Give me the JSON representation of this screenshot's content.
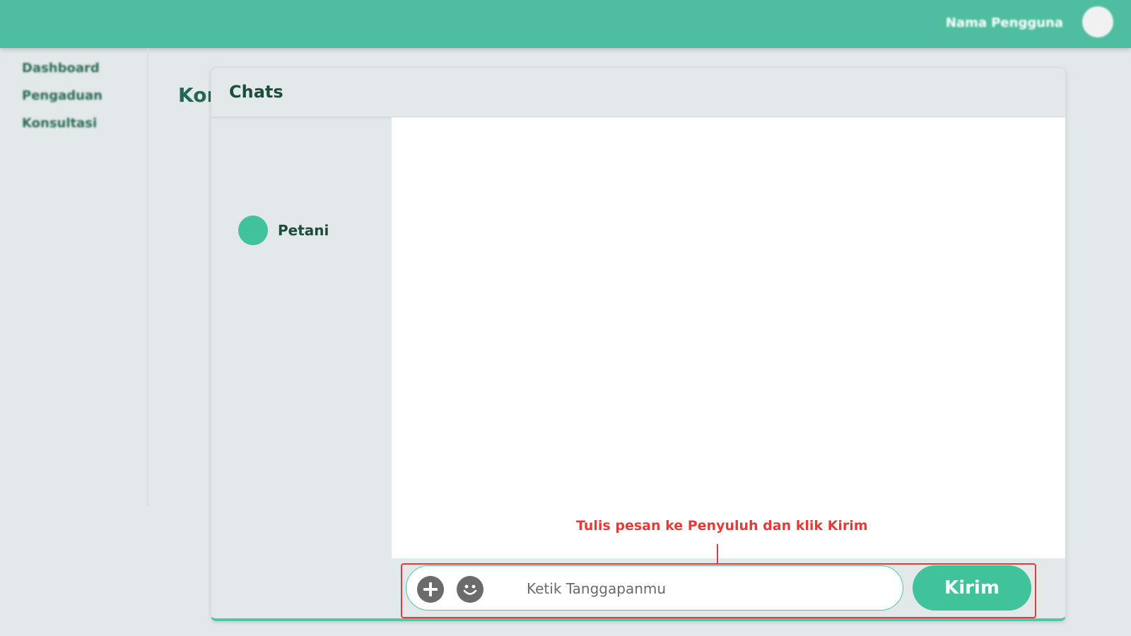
{
  "topbar": {
    "user_name": "Nama Pengguna",
    "brand_color": "#4fbd9f"
  },
  "sidebar": {
    "items": [
      {
        "label": "Dashboard"
      },
      {
        "label": "Pengaduan"
      },
      {
        "label": "Konsultasi"
      }
    ]
  },
  "page": {
    "title": "Konsultasi"
  },
  "chat": {
    "title": "Chats",
    "contacts": [
      {
        "name": "Petani",
        "avatar_color": "#40c39a"
      }
    ],
    "composer": {
      "placeholder": "Ketik Tanggapanmu",
      "attach_icon": "plus-icon",
      "emoji_icon": "emoji-icon",
      "send_label": "Kirim"
    }
  },
  "annotation": {
    "text": "Tulis pesan ke Penyuluh dan klik Kirim",
    "color": "#e53a3a"
  }
}
